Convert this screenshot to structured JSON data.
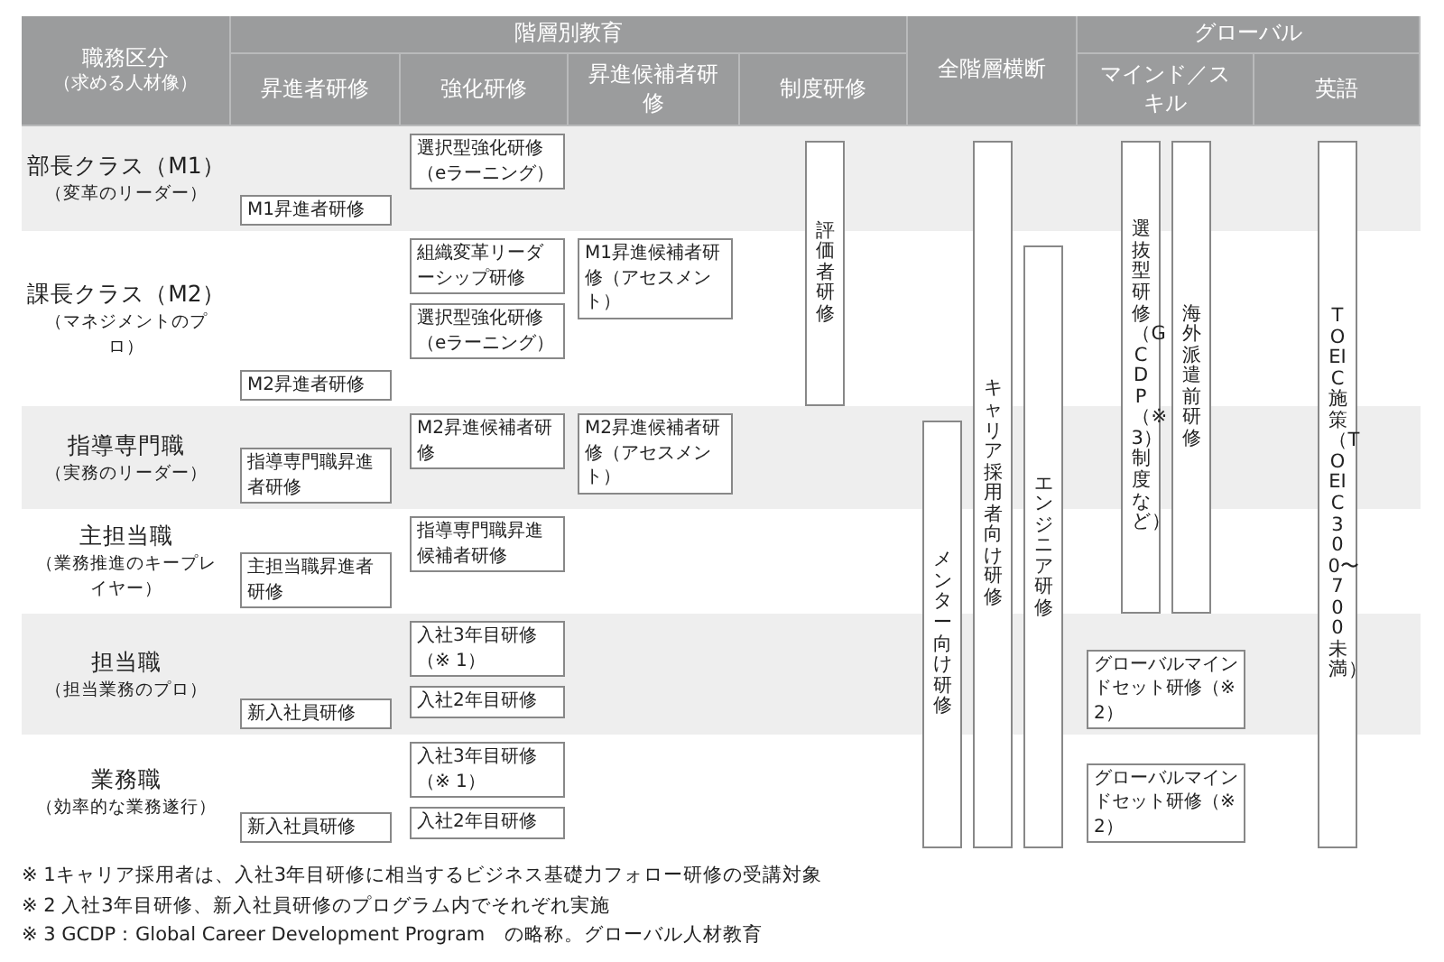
{
  "header": {
    "category": {
      "title": "職務区分",
      "subtitle": "（求める人材像）"
    },
    "groups": [
      {
        "label": "階層別教育",
        "columns": [
          "昇進者研修",
          "強化研修",
          "昇進候補者研修",
          "制度研修"
        ]
      },
      {
        "label": "全階層横断"
      },
      {
        "label": "グローバル",
        "columns": [
          "マインド／スキル",
          "英語"
        ]
      }
    ]
  },
  "rows": [
    {
      "title": "部長クラス（M1）",
      "subtitle": "（変革のリーダー）",
      "promotion": [
        "M1昇進者研修"
      ],
      "enhancement": [
        "選択型強化研修（eラーニング）"
      ]
    },
    {
      "title": "課長クラス（M2）",
      "subtitle": "（マネジメントのプロ）",
      "promotion": [
        "M2昇進者研修"
      ],
      "enhancement": [
        "組織変革リーダーシップ研修",
        "選択型強化研修（eラーニング）"
      ],
      "candidate": [
        "M1昇進候補者研修（アセスメント）"
      ]
    },
    {
      "title": "指導専門職",
      "subtitle": "（実務のリーダー）",
      "promotion": [
        "指導専門職昇進者研修"
      ],
      "enhancement": [
        "M2昇進候補者研修"
      ],
      "candidate": [
        "M2昇進候補者研修（アセスメント）"
      ]
    },
    {
      "title": "主担当職",
      "subtitle": "（業務推進のキープレイヤー）",
      "promotion": [
        "主担当職昇進者研修"
      ],
      "enhancement": [
        "指導専門職昇進候補者研修"
      ]
    },
    {
      "title": "担当職",
      "subtitle": "（担当業務のプロ）",
      "promotion": [
        "新入社員研修"
      ],
      "enhancement": [
        "入社3年目研修（※ 1）",
        "入社2年目研修"
      ],
      "global_mindset": [
        "グローバルマインドセット研修（※ 2）"
      ]
    },
    {
      "title": "業務職",
      "subtitle": "（効率的な業務遂行）",
      "promotion": [
        "新入社員研修"
      ],
      "enhancement": [
        "入社3年目研修（※ 1）",
        "入社2年目研修"
      ],
      "global_mindset": [
        "グローバルマインドセット研修（※ 2）"
      ]
    }
  ],
  "long_programs": {
    "system": [
      "評価者研修"
    ],
    "cross_level": [
      "メンター向け研修",
      "キャリア採用者向け研修",
      "エンジニア研修"
    ],
    "global_mindset": [
      "選抜型研修（GCDP（※3）制度など）",
      "海外派遣前研修"
    ],
    "english": [
      "TOEIC施策（TOEIC 300〜700未満）"
    ]
  },
  "footnotes": [
    "※ 1キャリア採用者は、入社3年目研修に相当するビジネス基礎力フォロー研修の受講対象",
    "※ 2 入社3年目研修、新入社員研修のプログラム内でそれぞれ実施",
    "※ 3 GCDP：Global Career Development Program　の略称。グローバル人材教育"
  ]
}
